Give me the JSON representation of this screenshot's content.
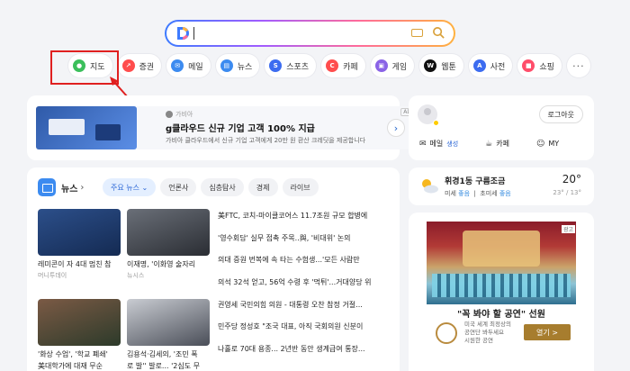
{
  "search": {
    "value": ""
  },
  "shortcuts": [
    {
      "label": "지도",
      "icon": "map-pin-icon",
      "color": "#3bbf5b"
    },
    {
      "label": "증권",
      "icon": "stock-icon",
      "color": "#ff4d4d"
    },
    {
      "label": "메일",
      "icon": "mail-icon",
      "color": "#3c8bf0"
    },
    {
      "label": "뉴스",
      "icon": "news-icon",
      "color": "#3c8bf0"
    },
    {
      "label": "스포츠",
      "icon": "sports-icon",
      "color": "#3c6cf0"
    },
    {
      "label": "카페",
      "icon": "cafe-icon",
      "color": "#ff4d4d"
    },
    {
      "label": "게임",
      "icon": "game-icon",
      "color": "#8a63e6"
    },
    {
      "label": "웹툰",
      "icon": "webtoon-icon",
      "color": "#111111"
    },
    {
      "label": "사전",
      "icon": "dictionary-icon",
      "color": "#3c6cf0"
    },
    {
      "label": "쇼핑",
      "icon": "shopping-icon",
      "color": "#ff4d6a"
    }
  ],
  "ad": {
    "source": "가비아",
    "headline": "g클라우드 신규 기업 고객 100% 지급",
    "description": "가비아 클라우드에서 신규 기업 고객에게 20만 원 환산 크레딧을 제공합니다",
    "tag": "AD"
  },
  "news": {
    "title": "뉴스",
    "tabs": [
      "주요 뉴스",
      "언론사",
      "심층탐사",
      "경제",
      "라이브"
    ],
    "thumbs": [
      {
        "caption": "레미콘이 자 4대 멈친 참",
        "press": "머니투데이",
        "color": "#1f3f74"
      },
      {
        "caption": "이재명, '이화영 술자리",
        "press": "뉴시스",
        "color": "#444a55"
      },
      {
        "caption": "'화상 수업', '학교 폐쇄'",
        "press": "美대학가에 대재 무순",
        "color": "#5b3a2e"
      },
      {
        "caption": "김용석·김세의, '조민 폭",
        "press": "로 발'' 발로... '2심도 무",
        "color": "#3a3f4a"
      }
    ],
    "headlines": [
      "美FTC, 코치-마이클코어스 11.7조원 규모 합병에",
      "'영수회담' 실무 접촉 주목..與, '비대위' 논의",
      "의대 증원 번복에 속 타는 수험생...'모든 사람만",
      "의석 32석 얻고, 56억 수령 후 '먹튀'...거대양당 위",
      "권영세 국민의힘 의원 - 대통령 오찬 참정 거절...",
      "민주당 정성호 \"조국 대표, 아직 국회의원 신분이",
      "나홀로 70대 용종... 2년반 동안 생계급여 통장..."
    ]
  },
  "account": {
    "logout": "로그아웃",
    "mail": "메일",
    "mail_new": "생성",
    "cafe": "카페",
    "my": "MY"
  },
  "weather": {
    "condition": "휘경1동 구름조금",
    "dust_label": "미세",
    "dust_value": "좋음",
    "ultra_label": "초미세",
    "ultra_value": "좋음",
    "temp": "20°",
    "range": "23° / 13°"
  },
  "promo": {
    "badge": "광고",
    "title": "\"꼭 봐야 할 공연\" 선원",
    "desc1": "미국 세계 최정상의",
    "desc2": "공연단 봐두세요",
    "desc3": "시원한 공연",
    "open": "열기 >"
  }
}
